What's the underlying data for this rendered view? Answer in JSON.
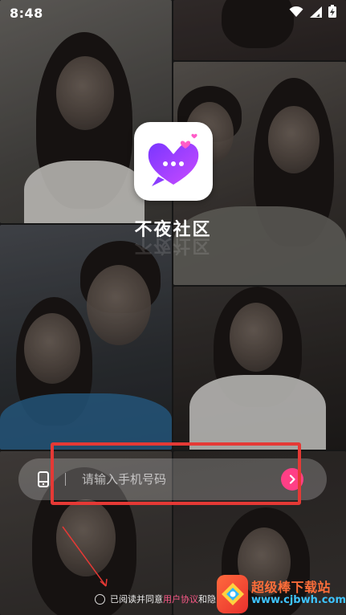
{
  "status_bar": {
    "time": "8:48"
  },
  "app": {
    "name": "不夜社区",
    "brand_gradient": [
      "#8b3cff",
      "#c64dff"
    ],
    "heart_color": "#ff5cc8"
  },
  "login": {
    "phone_placeholder": "请输入手机号码",
    "go_button_color": "#ff3f86"
  },
  "agreement": {
    "prefix": "已阅读并同意",
    "link_user_agreement": "用户协议",
    "conjunction": "和隐"
  },
  "watermark": {
    "title": "超级棒下载站",
    "url": "www.cjbwh.com"
  },
  "annotation": {
    "highlight_color": "#e53935"
  }
}
